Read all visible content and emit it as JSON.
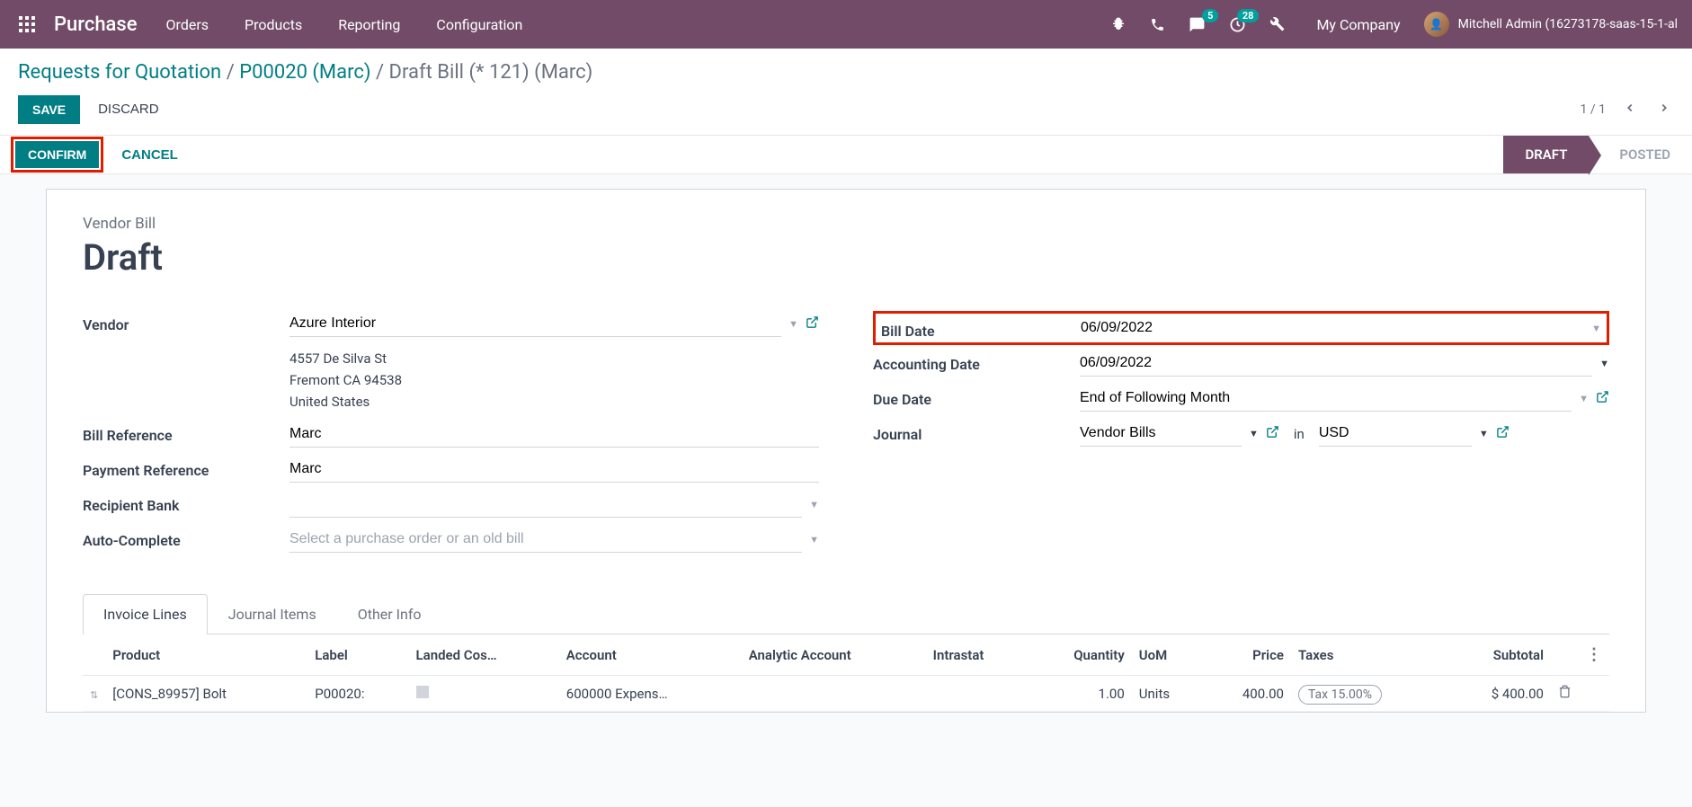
{
  "nav": {
    "brand": "Purchase",
    "menu": [
      "Orders",
      "Products",
      "Reporting",
      "Configuration"
    ],
    "msg_badge": "5",
    "activity_badge": "28",
    "company": "My Company",
    "user": "Mitchell Admin (16273178-saas-15-1-al"
  },
  "breadcrumb": {
    "a1": "Requests for Quotation",
    "a2": "P00020 (Marc)",
    "current": "Draft Bill (* 121) (Marc)"
  },
  "actions": {
    "save": "SAVE",
    "discard": "DISCARD"
  },
  "pager": {
    "text": "1 / 1"
  },
  "status": {
    "confirm": "CONFIRM",
    "cancel": "CANCEL",
    "draft": "DRAFT",
    "posted": "POSTED"
  },
  "doc": {
    "type": "Vendor Bill",
    "title": "Draft"
  },
  "left_fields": {
    "vendor_label": "Vendor",
    "vendor_value": "Azure Interior",
    "addr1": "4557 De Silva St",
    "addr2": "Fremont CA 94538",
    "addr3": "United States",
    "billref_label": "Bill Reference",
    "billref_value": "Marc",
    "payref_label": "Payment Reference",
    "payref_value": "Marc",
    "bank_label": "Recipient Bank",
    "bank_value": "",
    "auto_label": "Auto-Complete",
    "auto_placeholder": "Select a purchase order or an old bill"
  },
  "right_fields": {
    "billdate_label": "Bill Date",
    "billdate_value": "06/09/2022",
    "accdate_label": "Accounting Date",
    "accdate_value": "06/09/2022",
    "due_label": "Due Date",
    "due_value": "End of Following Month",
    "journal_label": "Journal",
    "journal_value": "Vendor Bills",
    "in_label": "in",
    "currency_value": "USD"
  },
  "tabs": [
    "Invoice Lines",
    "Journal Items",
    "Other Info"
  ],
  "table": {
    "headers": [
      "Product",
      "Label",
      "Landed Cos…",
      "Account",
      "Analytic Account",
      "Intrastat",
      "Quantity",
      "UoM",
      "Price",
      "Taxes",
      "Subtotal"
    ],
    "row": {
      "product": "[CONS_89957] Bolt",
      "label": "P00020:",
      "account": "600000 Expens…",
      "qty": "1.00",
      "uom": "Units",
      "price": "400.00",
      "tax": "Tax 15.00%",
      "subtotal": "$ 400.00"
    }
  }
}
